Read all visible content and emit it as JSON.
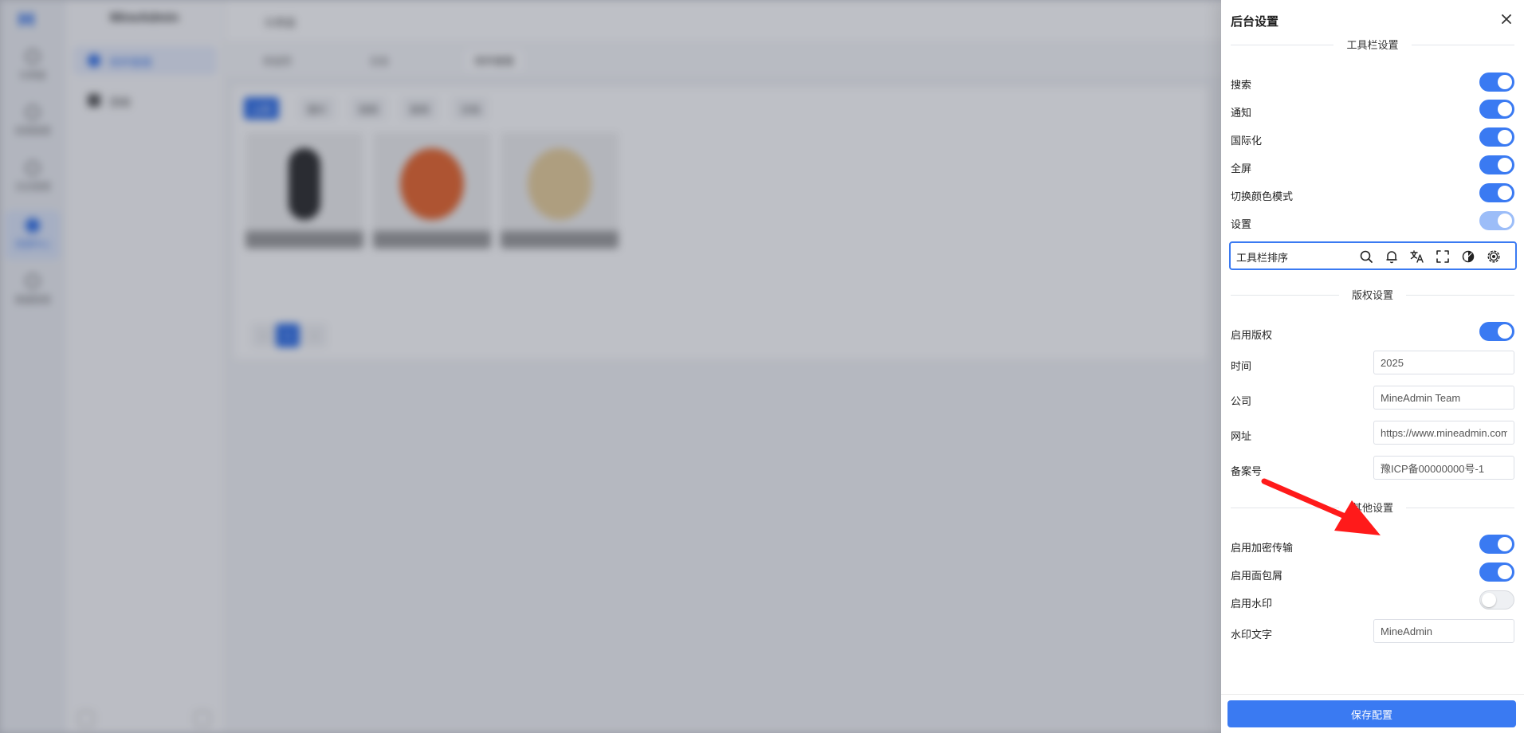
{
  "app": {
    "brand": "MineAdmin",
    "rail": [
      {
        "label": "仪表盘"
      },
      {
        "label": "权限管理"
      },
      {
        "label": "日志管理"
      },
      {
        "label": "资源中心"
      },
      {
        "label": "数据管理"
      }
    ],
    "submenu": [
      {
        "label": "附件管理"
      },
      {
        "label": "回收"
      }
    ],
    "breadcrumb": "仪表盘",
    "tabs": [
      {
        "label": "欢迎页"
      },
      {
        "label": "日志"
      },
      {
        "label": "附件管理"
      }
    ],
    "toolbar": [
      {
        "label": "上传"
      },
      {
        "label": "图片"
      },
      {
        "label": "视频"
      },
      {
        "label": "音频"
      },
      {
        "label": "文档"
      }
    ],
    "pager": {
      "current": "1"
    }
  },
  "drawer": {
    "title": "后台设置",
    "sections": {
      "toolbar": "工具栏设置",
      "copyright": "版权设置",
      "other": "其他设置"
    },
    "toolbar_settings": [
      {
        "label": "搜索",
        "enabled": true
      },
      {
        "label": "通知",
        "enabled": true
      },
      {
        "label": "国际化",
        "enabled": true
      },
      {
        "label": "全屏",
        "enabled": true
      },
      {
        "label": "切换颜色模式",
        "enabled": true
      },
      {
        "label": "设置",
        "enabled": true,
        "disabled": true
      }
    ],
    "toolbar_sort": {
      "label": "工具栏排序",
      "icons": [
        "search-icon",
        "bell-icon",
        "translate-icon",
        "fullscreen-icon",
        "color-mode-icon",
        "settings-icon"
      ]
    },
    "copyright": {
      "enable_label": "启用版权",
      "enabled": true,
      "time_label": "时间",
      "time_value": "2025",
      "company_label": "公司",
      "company_value": "MineAdmin Team",
      "url_label": "网址",
      "url_value": "https://www.mineadmin.com",
      "icp_label": "备案号",
      "icp_value": "豫ICP备00000000号-1"
    },
    "other": {
      "encrypt_label": "启用加密传输",
      "encrypt_enabled": true,
      "breadcrumb_label": "启用面包屑",
      "breadcrumb_enabled": true,
      "watermark_label": "启用水印",
      "watermark_enabled": false,
      "watermark_text_label": "水印文字",
      "watermark_text_value": "MineAdmin"
    },
    "save_label": "保存配置"
  },
  "colors": {
    "accent": "#3a7af2",
    "annotation": "#ff1a1a"
  }
}
